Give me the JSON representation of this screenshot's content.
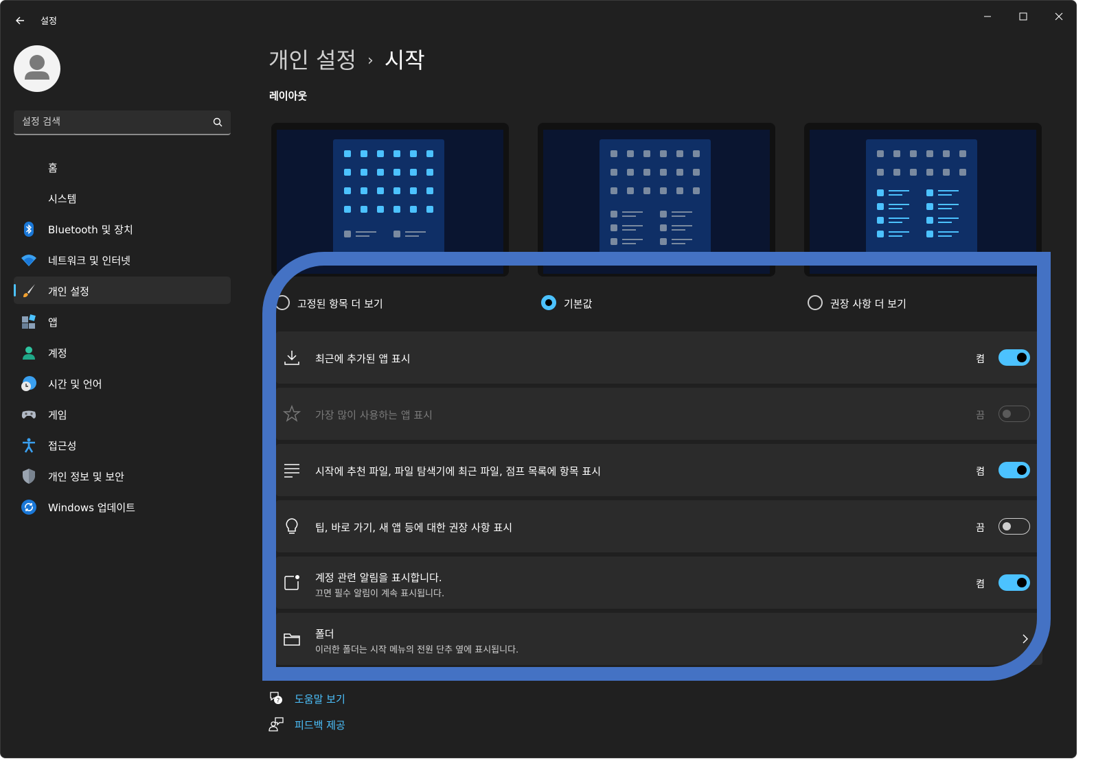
{
  "window": {
    "title": "설정"
  },
  "search": {
    "placeholder": "설정 검색"
  },
  "sidebar": {
    "items": [
      {
        "label": "홈",
        "icon": "home-icon"
      },
      {
        "label": "시스템",
        "icon": "system-icon"
      },
      {
        "label": "Bluetooth 및 장치",
        "icon": "bluetooth-icon"
      },
      {
        "label": "네트워크 및 인터넷",
        "icon": "wifi-icon"
      },
      {
        "label": "개인 설정",
        "icon": "brush-icon",
        "active": true
      },
      {
        "label": "앱",
        "icon": "apps-icon"
      },
      {
        "label": "계정",
        "icon": "account-icon"
      },
      {
        "label": "시간 및 언어",
        "icon": "globe-clock-icon"
      },
      {
        "label": "게임",
        "icon": "gamepad-icon"
      },
      {
        "label": "접근성",
        "icon": "accessibility-icon"
      },
      {
        "label": "개인 정보 및 보안",
        "icon": "shield-icon"
      },
      {
        "label": "Windows 업데이트",
        "icon": "update-icon"
      }
    ]
  },
  "header": {
    "parent": "개인 설정",
    "separator": "›",
    "current": "시작"
  },
  "layout": {
    "title": "레이아웃",
    "options": [
      {
        "label": "고정된 항목 더 보기",
        "selected": false
      },
      {
        "label": "기본값",
        "selected": true
      },
      {
        "label": "권장 사항 더 보기",
        "selected": false
      }
    ]
  },
  "settings": [
    {
      "title": "최근에 추가된 앱 표시",
      "state": "켬",
      "on": true,
      "icon": "download-icon"
    },
    {
      "title": "가장 많이 사용하는 앱 표시",
      "state": "끔",
      "on": false,
      "disabled": true,
      "icon": "star-icon"
    },
    {
      "title": "시작에 추천 파일, 파일 탐색기에 최근 파일, 점프 목록에 항목 표시",
      "state": "켬",
      "on": true,
      "icon": "list-icon"
    },
    {
      "title": "팁, 바로 가기, 새 앱 등에 대한 권장 사항 표시",
      "state": "끔",
      "on": false,
      "icon": "lightbulb-icon"
    },
    {
      "title": "계정 관련 알림을 표시합니다.",
      "subtitle": "끄면 필수 알림이 계속 표시됩니다.",
      "state": "켬",
      "on": true,
      "icon": "notification-icon"
    },
    {
      "title": "폴더",
      "subtitle": "이러한 폴더는 시작 메뉴의 전원 단추 옆에 표시됩니다.",
      "icon": "folder-icon"
    }
  ],
  "footer": {
    "help": "도움말 보기",
    "feedback": "피드백 제공"
  },
  "colors": {
    "accent": "#4cc2ff",
    "highlight_frame": "#4472c4",
    "background": "#202020"
  }
}
